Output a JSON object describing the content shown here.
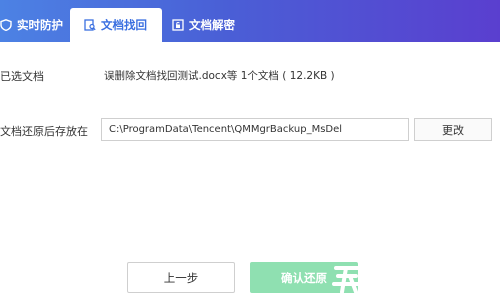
{
  "tabs": {
    "protect_label": "实时防护",
    "recover_label": "文档找回",
    "decrypt_label": "文档解密"
  },
  "selected": {
    "label": "已选文档",
    "value": "误删除文档找回测试.docx等 1个文档 ( 12.2KB )"
  },
  "restore": {
    "label": "文档还原后存放在",
    "path": "C:\\ProgramData\\Tencent\\QMMgrBackup_MsDel",
    "change_label": "更改"
  },
  "footer": {
    "back_label": "上一步",
    "confirm_label": "确认还原"
  },
  "colors": {
    "accent": "#3a6fe0",
    "confirm": "#8fe0b1"
  },
  "icons": [
    "shield-icon",
    "document-search-icon",
    "unlock-icon"
  ]
}
